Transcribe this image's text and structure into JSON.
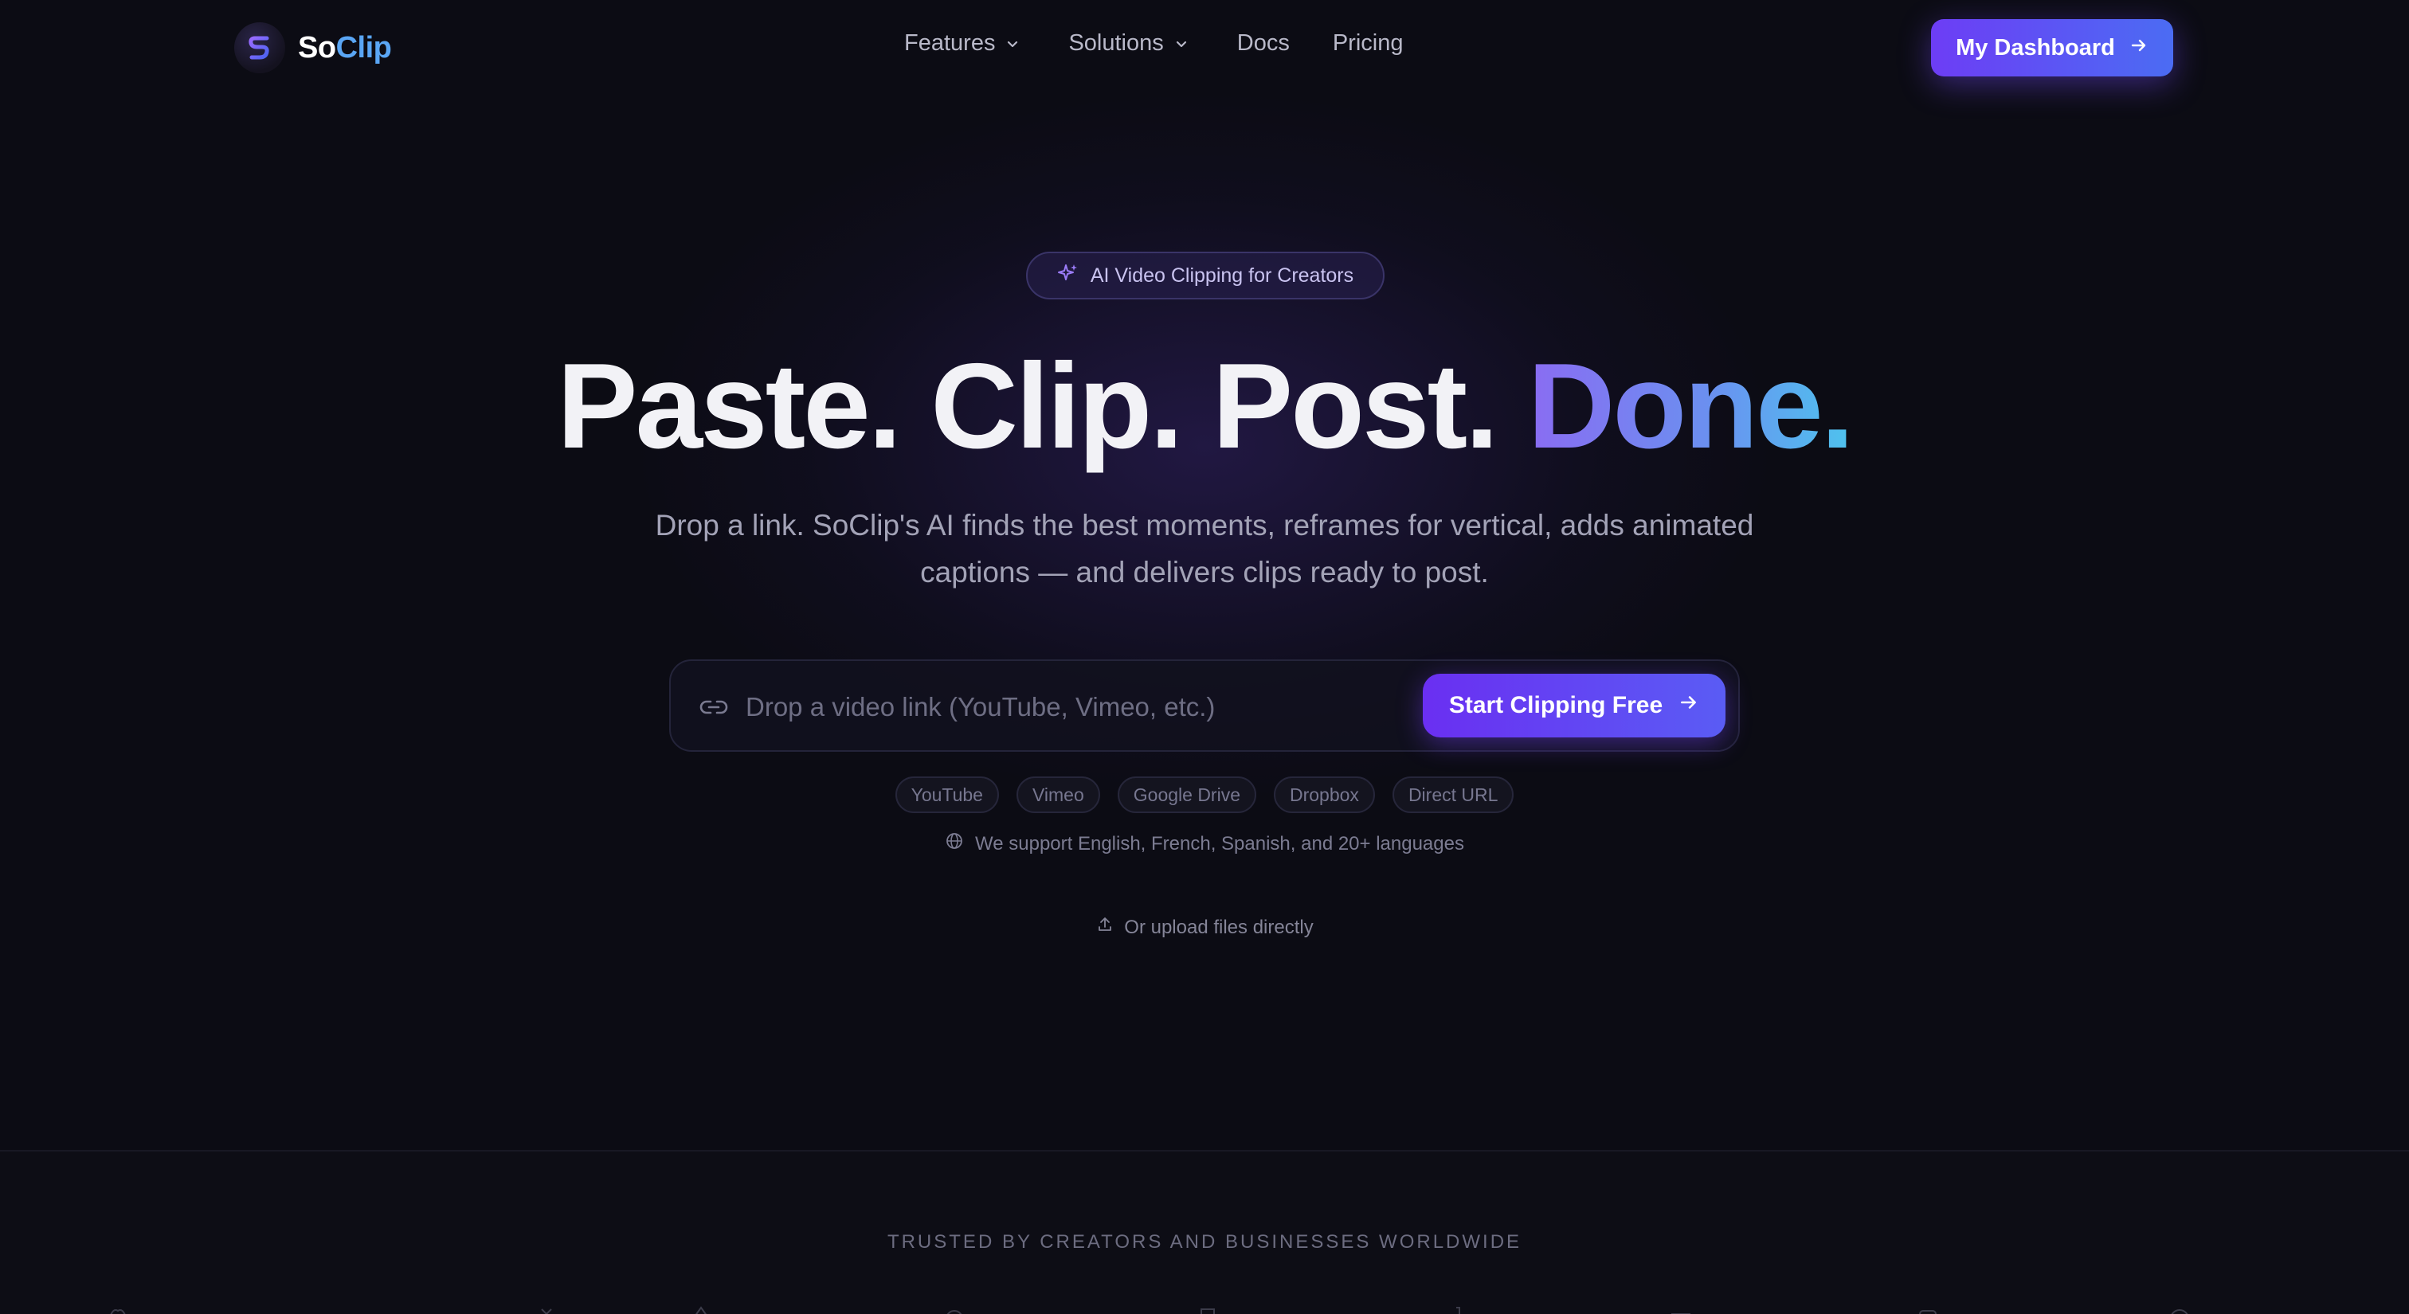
{
  "nav": {
    "brand_so": "So",
    "brand_clip": "Clip",
    "links": [
      {
        "label": "Features",
        "dropdown": true
      },
      {
        "label": "Solutions",
        "dropdown": true
      },
      {
        "label": "Docs",
        "dropdown": false
      },
      {
        "label": "Pricing",
        "dropdown": false
      }
    ],
    "dashboard_label": "My Dashboard"
  },
  "hero": {
    "badge": "AI Video Clipping for Creators",
    "headline_plain": "Paste. Clip. Post. ",
    "headline_accent": "Done",
    "headline_dot": ".",
    "subtitle": "Drop a link. SoClip's AI finds the best moments, reframes for vertical, adds animated captions — and delivers clips ready to post.",
    "search_placeholder": "Drop a video link (YouTube, Vimeo, etc.)",
    "cta_label": "Start Clipping Free",
    "sources": [
      "YouTube",
      "Vimeo",
      "Google Drive",
      "Dropbox",
      "Direct URL"
    ],
    "languages_note": "We support English, French, Spanish, and 20+ languages",
    "upload_label": "Or upload files directly"
  },
  "trusted": {
    "heading": "TRUSTED BY CREATORS AND BUSINESSES WORLDWIDE"
  },
  "colors": {
    "background": "#0c0c14",
    "accent_purple": "#6d3df5",
    "accent_blue": "#4b6cf3",
    "brand_clip": "#5aa6f5",
    "done_gradient_start": "#8a6cf2",
    "done_gradient_end": "#4ec3ee"
  },
  "icons": {
    "logo": "soclip-logo-icon",
    "chevron": "chevron-down-icon",
    "arrow": "arrow-right-icon",
    "sparkle": "sparkle-icon",
    "link": "link-icon",
    "globe": "globe-icon",
    "upload": "upload-icon"
  }
}
